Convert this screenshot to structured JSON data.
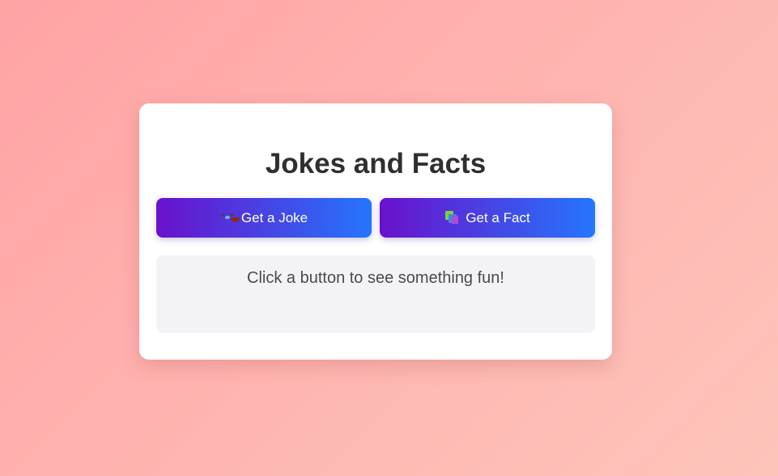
{
  "app": {
    "title": "Jokes and Facts"
  },
  "buttons": {
    "joke": {
      "icon": "laughing-face-icon",
      "label": "Get a Joke"
    },
    "fact": {
      "icon": "books-icon",
      "label": "Get a Fact"
    }
  },
  "output": {
    "text": "Click a button to see something fun!"
  },
  "colors": {
    "background_start": "#ffa3a5",
    "background_end": "#fdc4ba",
    "button_gradient_start": "#6a11cb",
    "button_gradient_end": "#2575fc",
    "card": "#ffffff",
    "output_panel": "#f3f3f7",
    "title_text": "#2f2f2f"
  }
}
